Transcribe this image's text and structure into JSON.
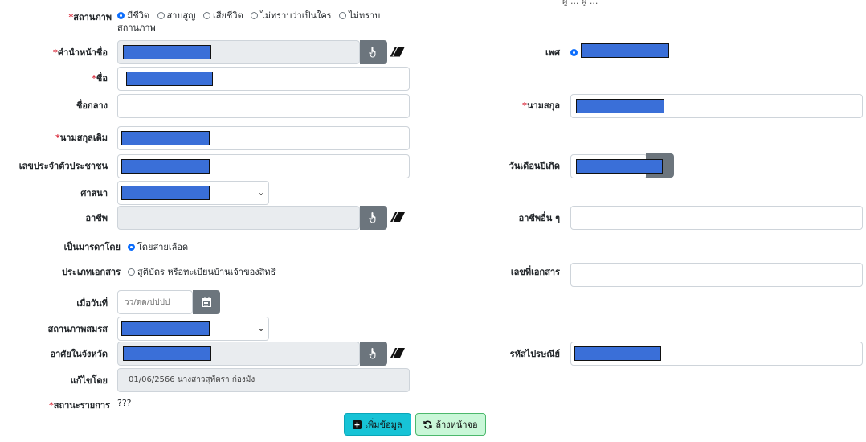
{
  "top_cut_text": "ผู้ ... ผู้ ...",
  "status": {
    "label": "สถานภาพ",
    "options": [
      "มีชีวิต",
      "สาบสูญ",
      "เสียชีวิต",
      "ไม่ทราบว่าเป็นใคร",
      "ไม่ทราบ"
    ],
    "wrap": "สถานภาพ",
    "selected": "มีชีวิต"
  },
  "prefix": {
    "label": "คำนำหน้าชื่อ"
  },
  "gender": {
    "label": "เพศ"
  },
  "firstname": {
    "label": "ชื่อ"
  },
  "middlename": {
    "label": "ชื่อกลาง"
  },
  "lastname": {
    "label": "นามสกุล"
  },
  "maiden": {
    "label": "นามสกุลเดิม"
  },
  "citizen_id": {
    "label": "เลขประจำตัวประชาชน"
  },
  "birthdate": {
    "label": "วันเดือนปีเกิด"
  },
  "religion": {
    "label": "ศาสนา"
  },
  "occupation": {
    "label": "อาชีพ"
  },
  "other_occupation": {
    "label": "อาชีพอื่น ๆ"
  },
  "parent_by": {
    "label": "เป็นมารดาโดย",
    "option": "โดยสายเลือด"
  },
  "doc_type": {
    "label": "ประเภทเอกสาร",
    "option": "สูติบัตร หรือทะเบียนบ้านเจ้าของสิทธิ"
  },
  "doc_no": {
    "label": "เลขที่เอกสาร"
  },
  "date": {
    "label": "เมื่อวันที่",
    "placeholder": "วว/ดด/ปปปป"
  },
  "marital": {
    "label": "สถานภาพสมรส"
  },
  "province": {
    "label": "อาศัยในจังหวัด"
  },
  "postal": {
    "label": "รหัสไปรษณีย์"
  },
  "edited_by": {
    "label": "แก้ไขโดย",
    "value": "01/06/2566 นางสาวสุพัตรา  ก่องมัง"
  },
  "record_status": {
    "label": "สถานะรายการ",
    "value": "???"
  },
  "buttons": {
    "add": "เพิ่มข้อมูล",
    "clear": "ล้างหน้าจอ"
  },
  "colors": {
    "required": "#dc3545",
    "redaction": "#3a6fd8",
    "primary": "#17c3d6",
    "success_light": "#c9f7d8"
  }
}
